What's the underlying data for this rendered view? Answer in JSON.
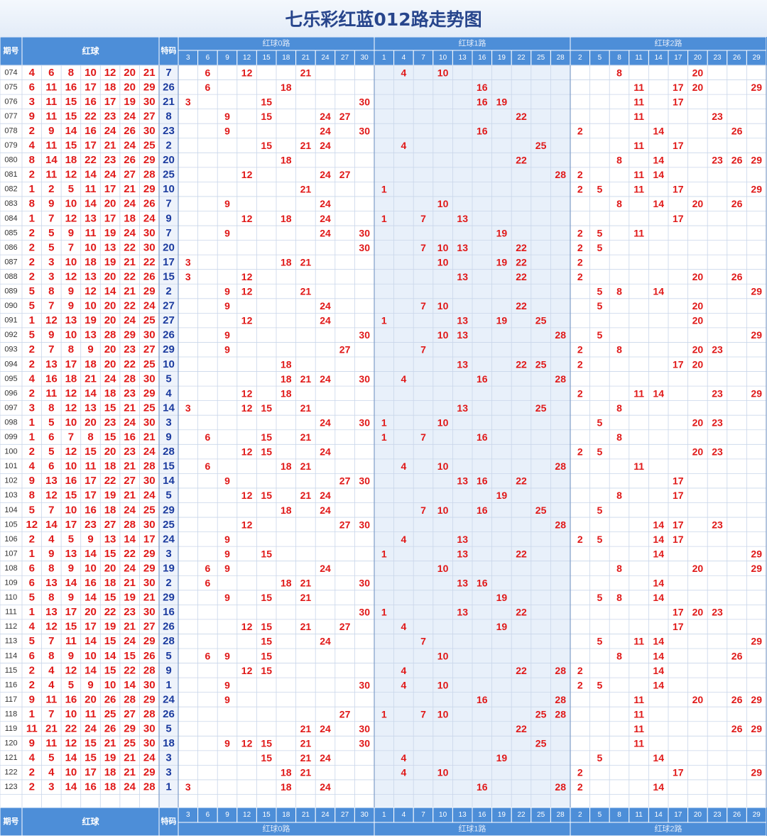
{
  "title": "七乐彩红蓝012路走势图",
  "headers": {
    "issue": "期号",
    "red": "红球",
    "special": "特码",
    "road0": "红球0路",
    "road1": "红球1路",
    "road2": "红球2路"
  },
  "road_numbers": {
    "road0": [
      "3",
      "6",
      "9",
      "12",
      "15",
      "18",
      "21",
      "24",
      "27",
      "30"
    ],
    "road1": [
      "1",
      "4",
      "7",
      "10",
      "13",
      "16",
      "19",
      "22",
      "25",
      "28"
    ],
    "road2": [
      "2",
      "5",
      "8",
      "11",
      "14",
      "17",
      "20",
      "23",
      "26",
      "29"
    ]
  },
  "colors": {
    "header_bg": "#4d8ed8",
    "red_text": "#e01818",
    "special_text": "#1a3a9e",
    "road1_bg": "#e8f0fa",
    "title_text": "#27458c"
  },
  "rows": [
    {
      "issue": "074",
      "red": [
        4,
        6,
        8,
        10,
        12,
        20,
        21
      ],
      "special": 7
    },
    {
      "issue": "075",
      "red": [
        6,
        11,
        16,
        17,
        18,
        20,
        29
      ],
      "special": 26
    },
    {
      "issue": "076",
      "red": [
        3,
        11,
        15,
        16,
        17,
        19,
        30
      ],
      "special": 21
    },
    {
      "issue": "077",
      "red": [
        9,
        11,
        15,
        22,
        23,
        24,
        27
      ],
      "special": 8
    },
    {
      "issue": "078",
      "red": [
        2,
        9,
        14,
        16,
        24,
        26,
        30
      ],
      "special": 23
    },
    {
      "issue": "079",
      "red": [
        4,
        11,
        15,
        17,
        21,
        24,
        25
      ],
      "special": 2
    },
    {
      "issue": "080",
      "red": [
        8,
        14,
        18,
        22,
        23,
        26,
        29
      ],
      "special": 20
    },
    {
      "issue": "081",
      "red": [
        2,
        11,
        12,
        14,
        24,
        27,
        28
      ],
      "special": 25
    },
    {
      "issue": "082",
      "red": [
        1,
        2,
        5,
        11,
        17,
        21,
        29
      ],
      "special": 10
    },
    {
      "issue": "083",
      "red": [
        8,
        9,
        10,
        14,
        20,
        24,
        26
      ],
      "special": 7
    },
    {
      "issue": "084",
      "red": [
        1,
        7,
        12,
        13,
        17,
        18,
        24
      ],
      "special": 9
    },
    {
      "issue": "085",
      "red": [
        2,
        5,
        9,
        11,
        19,
        24,
        30
      ],
      "special": 7
    },
    {
      "issue": "086",
      "red": [
        2,
        5,
        7,
        10,
        13,
        22,
        30
      ],
      "special": 20
    },
    {
      "issue": "087",
      "red": [
        2,
        3,
        10,
        18,
        19,
        21,
        22
      ],
      "special": 17
    },
    {
      "issue": "088",
      "red": [
        2,
        3,
        12,
        13,
        20,
        22,
        26
      ],
      "special": 15
    },
    {
      "issue": "089",
      "red": [
        5,
        8,
        9,
        12,
        14,
        21,
        29
      ],
      "special": 2
    },
    {
      "issue": "090",
      "red": [
        5,
        7,
        9,
        10,
        20,
        22,
        24
      ],
      "special": 27
    },
    {
      "issue": "091",
      "red": [
        1,
        12,
        13,
        19,
        20,
        24,
        25
      ],
      "special": 27
    },
    {
      "issue": "092",
      "red": [
        5,
        9,
        10,
        13,
        28,
        29,
        30
      ],
      "special": 26
    },
    {
      "issue": "093",
      "red": [
        2,
        7,
        8,
        9,
        20,
        23,
        27
      ],
      "special": 29
    },
    {
      "issue": "094",
      "red": [
        2,
        13,
        17,
        18,
        20,
        22,
        25
      ],
      "special": 10
    },
    {
      "issue": "095",
      "red": [
        4,
        16,
        18,
        21,
        24,
        28,
        30
      ],
      "special": 5
    },
    {
      "issue": "096",
      "red": [
        2,
        11,
        12,
        14,
        18,
        23,
        29
      ],
      "special": 4
    },
    {
      "issue": "097",
      "red": [
        3,
        8,
        12,
        13,
        15,
        21,
        25
      ],
      "special": 14
    },
    {
      "issue": "098",
      "red": [
        1,
        5,
        10,
        20,
        23,
        24,
        30
      ],
      "special": 3
    },
    {
      "issue": "099",
      "red": [
        1,
        6,
        7,
        8,
        15,
        16,
        21
      ],
      "special": 9
    },
    {
      "issue": "100",
      "red": [
        2,
        5,
        12,
        15,
        20,
        23,
        24
      ],
      "special": 28
    },
    {
      "issue": "101",
      "red": [
        4,
        6,
        10,
        11,
        18,
        21,
        28
      ],
      "special": 15
    },
    {
      "issue": "102",
      "red": [
        9,
        13,
        16,
        17,
        22,
        27,
        30
      ],
      "special": 14
    },
    {
      "issue": "103",
      "red": [
        8,
        12,
        15,
        17,
        19,
        21,
        24
      ],
      "special": 5
    },
    {
      "issue": "104",
      "red": [
        5,
        7,
        10,
        16,
        18,
        24,
        25
      ],
      "special": 29
    },
    {
      "issue": "105",
      "red": [
        12,
        14,
        17,
        23,
        27,
        28,
        30
      ],
      "special": 25
    },
    {
      "issue": "106",
      "red": [
        2,
        4,
        5,
        9,
        13,
        14,
        17
      ],
      "special": 24
    },
    {
      "issue": "107",
      "red": [
        1,
        9,
        13,
        14,
        15,
        22,
        29
      ],
      "special": 3
    },
    {
      "issue": "108",
      "red": [
        6,
        8,
        9,
        10,
        20,
        24,
        29
      ],
      "special": 19
    },
    {
      "issue": "109",
      "red": [
        6,
        13,
        14,
        16,
        18,
        21,
        30
      ],
      "special": 2
    },
    {
      "issue": "110",
      "red": [
        5,
        8,
        9,
        14,
        15,
        19,
        21
      ],
      "special": 29
    },
    {
      "issue": "111",
      "red": [
        1,
        13,
        17,
        20,
        22,
        23,
        30
      ],
      "special": 16
    },
    {
      "issue": "112",
      "red": [
        4,
        12,
        15,
        17,
        19,
        21,
        27
      ],
      "special": 26
    },
    {
      "issue": "113",
      "red": [
        5,
        7,
        11,
        14,
        15,
        24,
        29
      ],
      "special": 28
    },
    {
      "issue": "114",
      "red": [
        6,
        8,
        9,
        10,
        14,
        15,
        26
      ],
      "special": 5
    },
    {
      "issue": "115",
      "red": [
        2,
        4,
        12,
        14,
        15,
        22,
        28
      ],
      "special": 9
    },
    {
      "issue": "116",
      "red": [
        2,
        4,
        5,
        9,
        10,
        14,
        30
      ],
      "special": 1
    },
    {
      "issue": "117",
      "red": [
        9,
        11,
        16,
        20,
        26,
        28,
        29
      ],
      "special": 24
    },
    {
      "issue": "118",
      "red": [
        1,
        7,
        10,
        11,
        25,
        27,
        28
      ],
      "special": 26
    },
    {
      "issue": "119",
      "red": [
        11,
        21,
        22,
        24,
        26,
        29,
        30
      ],
      "special": 5
    },
    {
      "issue": "120",
      "red": [
        9,
        11,
        12,
        15,
        21,
        25,
        30
      ],
      "special": 18
    },
    {
      "issue": "121",
      "red": [
        4,
        5,
        14,
        15,
        19,
        21,
        24
      ],
      "special": 3
    },
    {
      "issue": "122",
      "red": [
        2,
        4,
        10,
        17,
        18,
        21,
        29
      ],
      "special": 3
    },
    {
      "issue": "123",
      "red": [
        2,
        3,
        14,
        16,
        18,
        24,
        28
      ],
      "special": 1
    }
  ]
}
